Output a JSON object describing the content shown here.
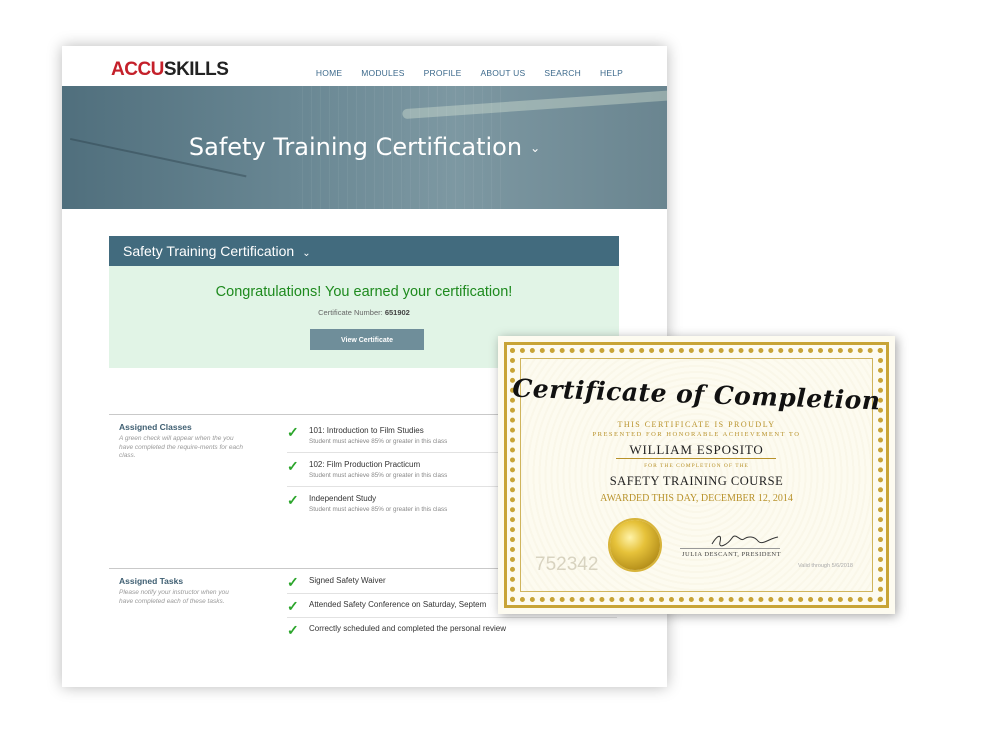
{
  "logo": {
    "part1": "ACCU",
    "part2": "SKILLS"
  },
  "nav": [
    "HOME",
    "MODULES",
    "PROFILE",
    "ABOUT US",
    "SEARCH",
    "HELP"
  ],
  "hero": {
    "title": "Safety Training Certification"
  },
  "panel": {
    "title": "Safety Training Certification",
    "congrats": "Congratulations!  You earned your certification!",
    "cert_label": "Certificate Number:",
    "cert_number": "651902",
    "view_button": "View Certificate"
  },
  "classes": {
    "title": "Assigned Classes",
    "note": "A green check will appear when the you have completed the require-ments for each class.",
    "items": [
      {
        "title": "101: Introduction to Film Studies",
        "sub": "Student must achieve 85% or greater in this class"
      },
      {
        "title": "102: Film Production Practicum",
        "sub": "Student must achieve 85% or greater in this class"
      },
      {
        "title": "Independent Study",
        "sub": "Student must achieve 85% or greater in this class"
      }
    ]
  },
  "tasks": {
    "title": "Assigned Tasks",
    "note": "Please notify your instructor when you have completed each of these tasks.",
    "items": [
      {
        "title": "Signed Safety Waiver"
      },
      {
        "title": "Attended Safety Conference on Saturday, Septem"
      },
      {
        "title": "Correctly scheduled and completed the personal review"
      }
    ]
  },
  "certificate": {
    "title": "Certificate of Completion",
    "line1": "THIS CERTIFICATE IS PROUDLY",
    "line2": "PRESENTED FOR HONORABLE ACHIEVEMENT TO",
    "name": "WILLIAM ESPOSITO",
    "line3": "FOR THE COMPLETION OF THE",
    "course": "SAFETY TRAINING COURSE",
    "date": "AWARDED THIS DAY, DECEMBER 12, 2014",
    "signature": "Julia Descant",
    "signer": "JULIA DESCANT, PRESIDENT",
    "serial": "752342",
    "valid": "Valid through 5/6/2018"
  },
  "colors": {
    "accent": "#426b7e",
    "success": "#1e8a1e",
    "gold": "#c8a437",
    "logo_red": "#c4202a"
  }
}
